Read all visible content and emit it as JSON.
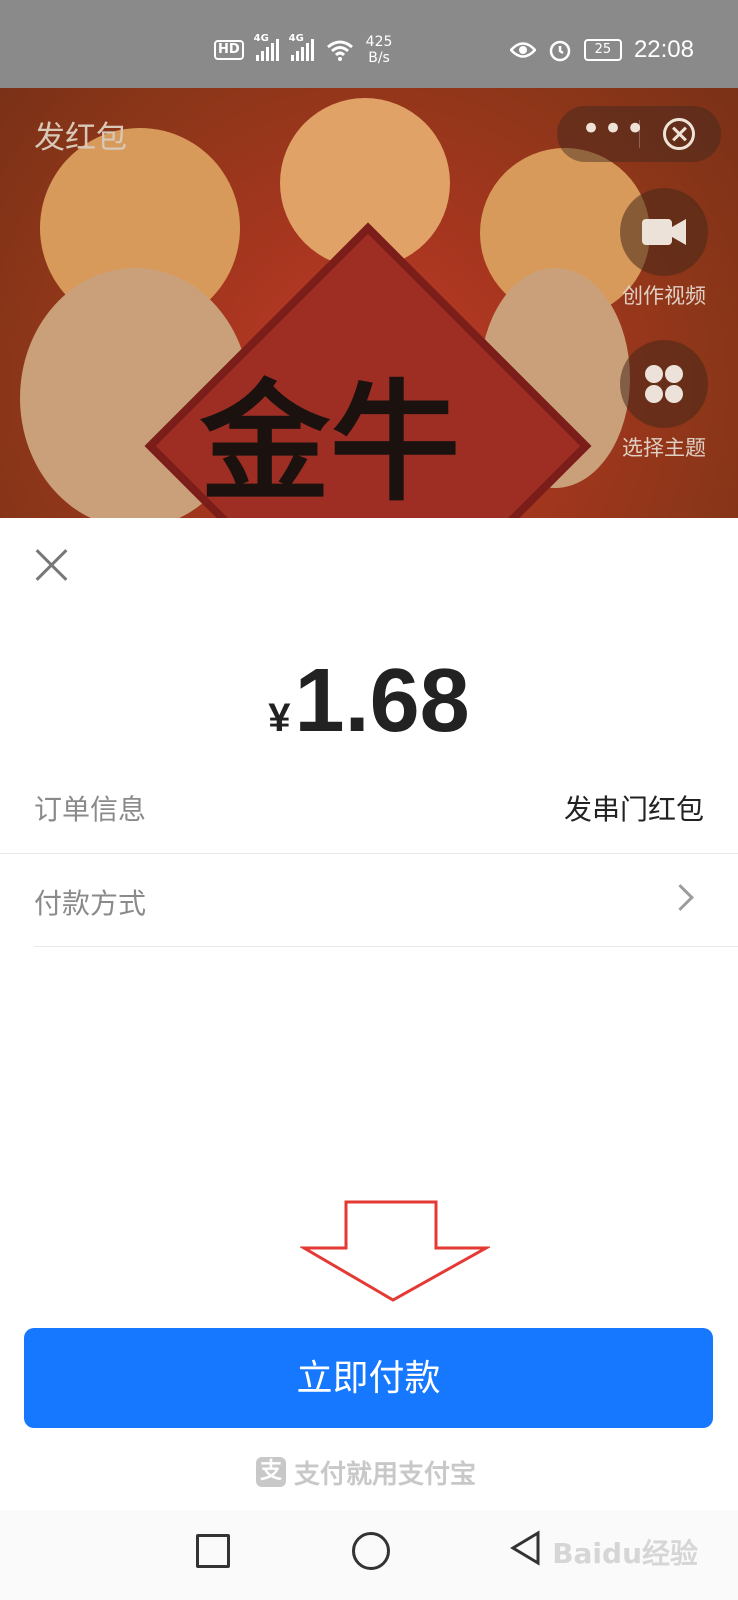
{
  "status_bar": {
    "hd": "HD",
    "net1": "4G",
    "net2": "4G",
    "speed_value": "425",
    "speed_unit": "B/s",
    "battery": "25",
    "time": "22:08"
  },
  "header": {
    "title": "发红包",
    "more_icon": "more-dots-icon",
    "close_icon": "close-circle-icon"
  },
  "side_actions": [
    {
      "label": "创作视频",
      "icon": "video-camera-icon"
    },
    {
      "label": "选择主题",
      "icon": "theme-grid-icon"
    }
  ],
  "banner_text": "金牛",
  "payment": {
    "currency": "¥",
    "amount": "1.68",
    "order_label": "订单信息",
    "order_value": "发串门红包",
    "method_label": "付款方式",
    "pay_button": "立即付款",
    "brand": "支付就用支付宝"
  },
  "watermark": "Baidu经验",
  "colors": {
    "primary": "#1677ff",
    "status_bar": "#8a8a8a",
    "arrow": "#e53935"
  }
}
